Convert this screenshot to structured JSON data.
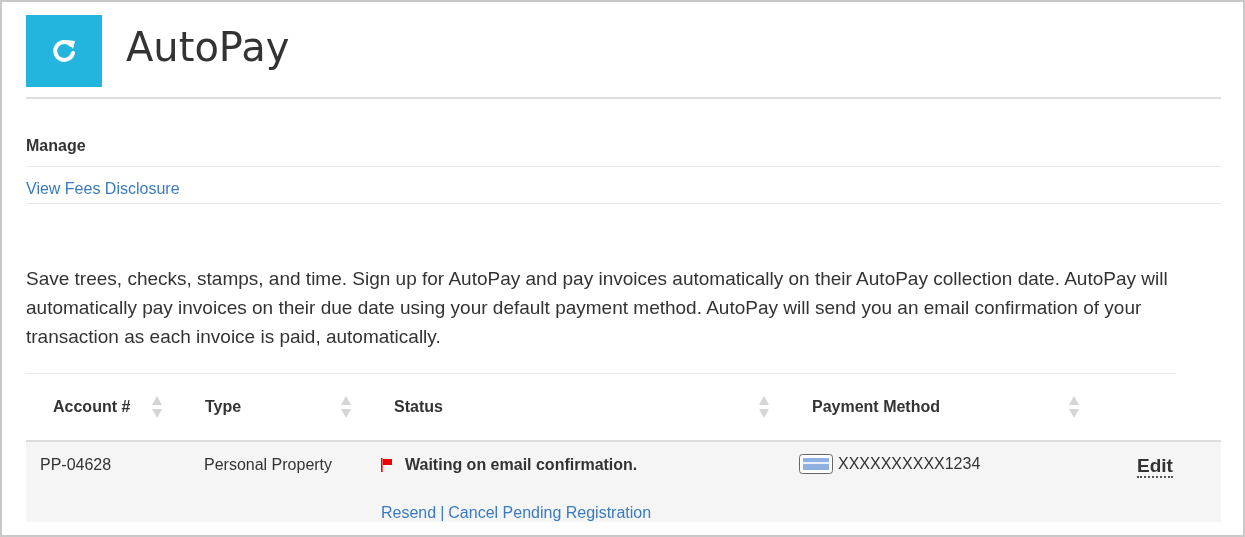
{
  "header": {
    "title": "AutoPay"
  },
  "manage": {
    "heading": "Manage",
    "link": "View Fees Disclosure"
  },
  "intro": "Save trees, checks, stamps, and time. Sign up for AutoPay and pay invoices automatically on their AutoPay collection date. AutoPay will automatically pay invoices on their due date using your default payment method. AutoPay will send you an email confirmation of your transaction as each invoice is paid, automatically.",
  "table": {
    "columns": [
      {
        "label": "Account #",
        "sortable": true
      },
      {
        "label": "Type",
        "sortable": true
      },
      {
        "label": "Status",
        "sortable": true
      },
      {
        "label": "Payment Method",
        "sortable": true
      }
    ],
    "rows": [
      {
        "account": "PP-04628",
        "type": "Personal Property",
        "status": {
          "text": "Waiting on email confirmation.",
          "flagged": true,
          "links": [
            "Resend",
            "Cancel Pending Registration"
          ],
          "separator": "|"
        },
        "payment": "XXXXXXXXXX1234",
        "action": "Edit"
      }
    ]
  }
}
